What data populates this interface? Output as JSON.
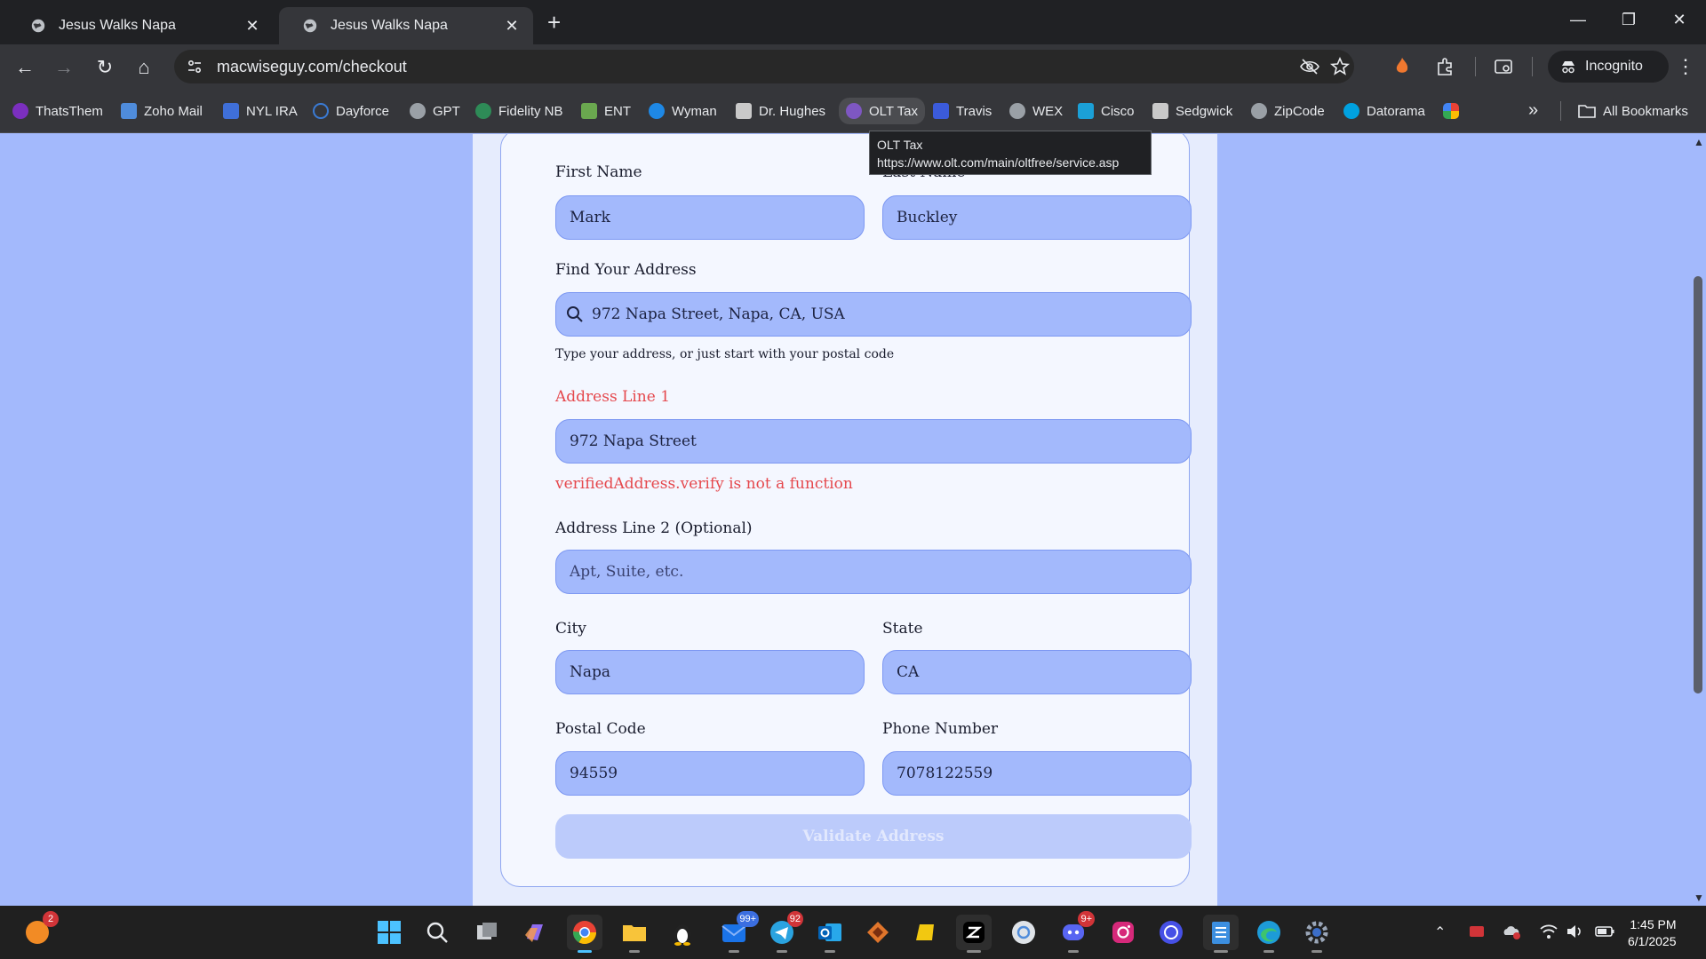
{
  "browser": {
    "tabs": [
      {
        "title": "Jesus Walks Napa",
        "active": false
      },
      {
        "title": "Jesus Walks Napa",
        "active": true
      }
    ],
    "url": "macwiseguy.com/checkout",
    "incognito_label": "Incognito",
    "bookmarks": [
      {
        "label": "ThatsThem",
        "color": "#7b2fbf"
      },
      {
        "label": "Zoho Mail",
        "color": "#4f8cdb"
      },
      {
        "label": "NYL IRA",
        "color": "#3f6fd8"
      },
      {
        "label": "Dayforce",
        "color": "#3a7bd5"
      },
      {
        "label": "GPT",
        "color": "#9aa0a6"
      },
      {
        "label": "Fidelity NB",
        "color": "#2e8b57"
      },
      {
        "label": "ENT",
        "color": "#6aa84f"
      },
      {
        "label": "Wyman",
        "color": "#1e88e5"
      },
      {
        "label": "Dr. Hughes",
        "color": "#c9c9c9"
      },
      {
        "label": "OLT Tax",
        "color": "#7e57c2"
      },
      {
        "label": "Travis",
        "color": "#3b5bdb"
      },
      {
        "label": "WEX",
        "color": "#9aa0a6"
      },
      {
        "label": "Cisco",
        "color": "#1ba0d7"
      },
      {
        "label": "Sedgwick",
        "color": "#c9c9c9"
      },
      {
        "label": "ZipCode",
        "color": "#9aa0a6"
      },
      {
        "label": "Datorama",
        "color": "#00a1e0"
      },
      {
        "label": "",
        "color": "#e94235"
      }
    ],
    "all_bookmarks_label": "All Bookmarks",
    "tooltip": {
      "title": "OLT Tax",
      "url": "https://www.olt.com/main/oltfree/service.asp"
    }
  },
  "form": {
    "first_name": {
      "label": "First Name",
      "value": "Mark"
    },
    "last_name": {
      "label": "Last Name",
      "value": "Buckley"
    },
    "find_address": {
      "label": "Find Your Address",
      "value": "972 Napa Street, Napa, CA, USA",
      "hint": "Type your address, or just start with your postal code"
    },
    "address_line1": {
      "label": "Address Line 1",
      "value": "972 Napa Street",
      "error": "verifiedAddress.verify is not a function"
    },
    "address_line2": {
      "label": "Address Line 2 (Optional)",
      "value": "",
      "placeholder": "Apt, Suite, etc."
    },
    "city": {
      "label": "City",
      "value": "Napa"
    },
    "state": {
      "label": "State",
      "value": "CA"
    },
    "postal_code": {
      "label": "Postal Code",
      "value": "94559"
    },
    "phone": {
      "label": "Phone Number",
      "value": "7078122559"
    },
    "validate_button": "Validate Address"
  },
  "taskbar": {
    "badges": {
      "notifications": "2",
      "mail": "99+",
      "telegram": "92",
      "discord": "9+"
    },
    "time": "1:45 PM",
    "date": "6/1/2025"
  }
}
